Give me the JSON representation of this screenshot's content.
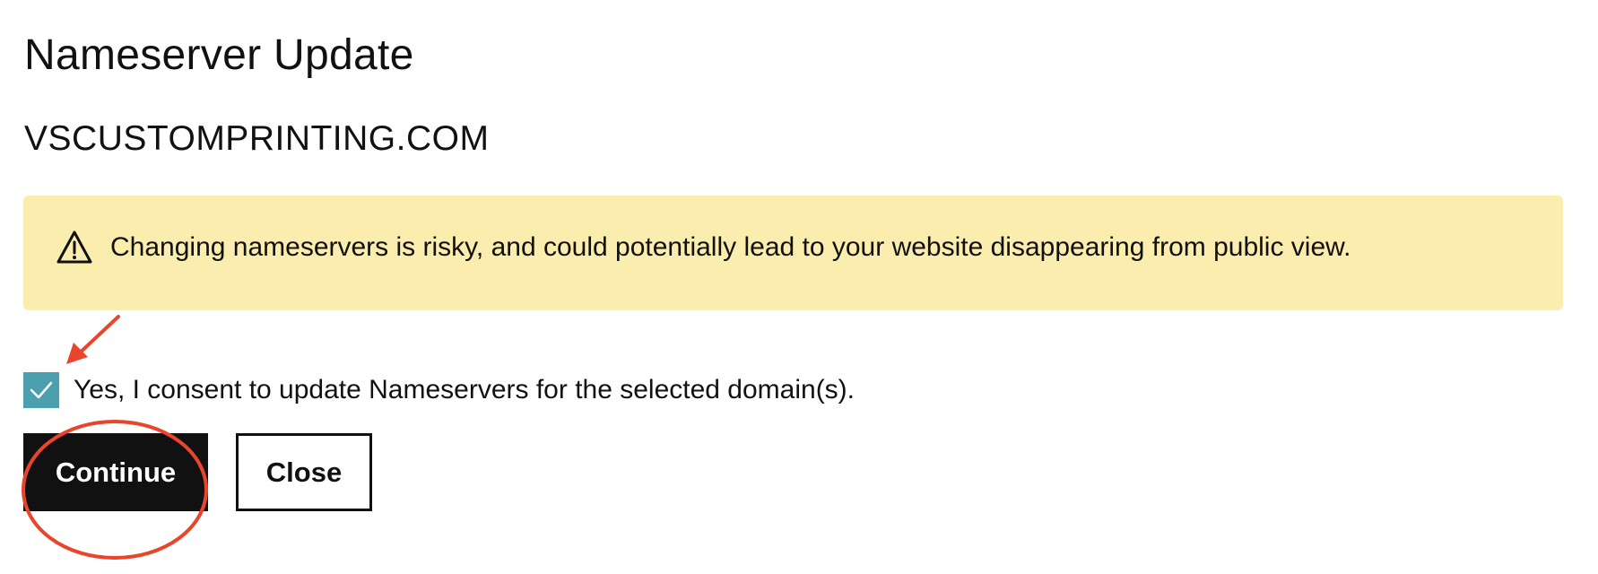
{
  "dialog": {
    "title": "Nameserver Update",
    "domain": "VSCUSTOMPRINTING.COM"
  },
  "alert": {
    "icon": "warning-triangle-icon",
    "message": "Changing nameservers is risky, and could potentially lead to your website disappearing from public view.",
    "background_color": "#faedae"
  },
  "consent": {
    "checked": true,
    "label": "Yes, I consent to update Nameservers for the selected domain(s).",
    "checkbox_color": "#4b9fae"
  },
  "actions": {
    "continue_label": "Continue",
    "close_label": "Close"
  },
  "annotations": {
    "color": "#e8452c",
    "arrow": "points-to-consent-checkbox",
    "circle": "highlights-continue-button"
  }
}
